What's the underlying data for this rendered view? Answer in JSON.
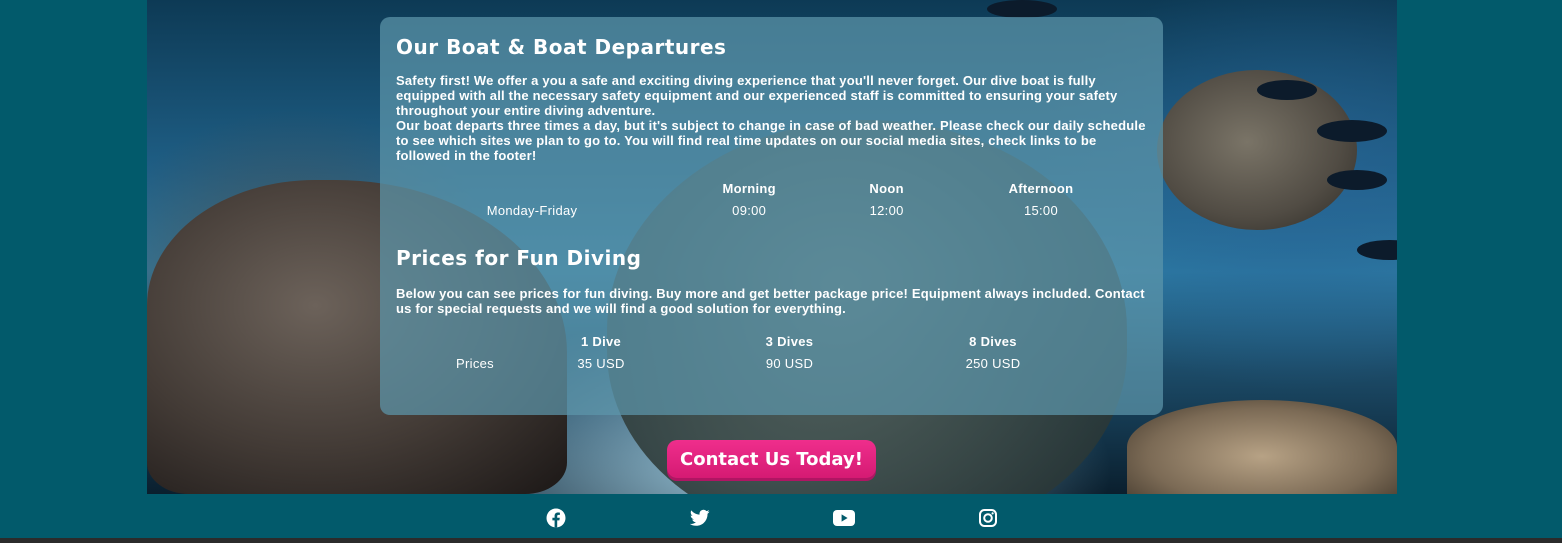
{
  "boat": {
    "heading": "Our Boat & Boat Departures",
    "para1": "Safety first! We offer a you a safe and exciting diving experience that you'll never forget. Our dive boat is fully equipped with all the necessary safety equipment and our experienced staff is committed to ensuring your safety throughout your entire diving adventure.",
    "para2": "Our boat departs three times a day, but it's subject to change in case of bad weather. Please check our daily schedule to see which sites we plan to go to. You will find real time updates on our social media sites, check links to be followed in the footer!",
    "schedule": {
      "headers": [
        "",
        "Morning",
        "Noon",
        "Afternoon"
      ],
      "row_label": "Monday-Friday",
      "times": [
        "09:00",
        "12:00",
        "15:00"
      ]
    }
  },
  "prices": {
    "heading": "Prices for Fun Diving",
    "para": "Below you can see prices for fun diving. Buy more and get better package price! Equipment always included. Contact us for special requests and we will find a good solution for everything.",
    "table": {
      "headers": [
        "",
        "1 Dive",
        "3 Dives",
        "8 Dives"
      ],
      "row_label": "Prices",
      "values": [
        "35 USD",
        "90 USD",
        "250 USD"
      ]
    }
  },
  "cta": {
    "label": "Contact Us Today!"
  },
  "footer": {
    "social_icons": [
      "facebook-icon",
      "twitter-icon",
      "youtube-icon",
      "instagram-icon"
    ]
  },
  "colors": {
    "page_bg": "#025a6b",
    "panel_bg": "rgba(93,150,170,0.72)",
    "cta_bg": "#e0247f",
    "text": "#ffffff"
  }
}
